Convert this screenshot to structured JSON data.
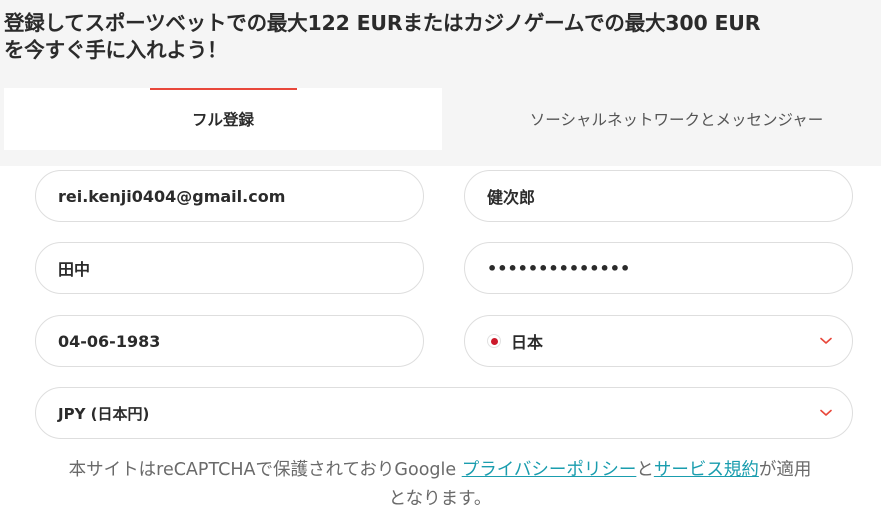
{
  "promo": {
    "headline": "登録してスポーツベットでの最大122 EURまたはカジノゲームでの最大300 EUR\nを今すぐ手に入れよう！"
  },
  "tabs": [
    {
      "label": "フル登録",
      "active": true
    },
    {
      "label": "ソーシャルネットワークとメッセンジャー",
      "active": false
    }
  ],
  "form": {
    "email": "rei.kenji0404@gmail.com",
    "first_name": "健次郎",
    "last_name": "田中",
    "password_masked": "••••••••••••••",
    "birth_date": "04-06-1983",
    "country": "日本",
    "currency": "JPY (日本円)"
  },
  "recaptcha": {
    "text_before": "本サイトはreCAPTCHAで保護されておりGoogle ",
    "privacy_link": "プライバシーポリシー",
    "connector": "と",
    "terms_link": "サービス規約",
    "text_after": "が適用となります。"
  },
  "colors": {
    "accent_red": "#e8473a",
    "link_teal": "#1a9dae",
    "japan_flag_red": "#cc1a2b"
  },
  "icons": {
    "chevron": "chevron-down-icon",
    "flag": "japan-flag-icon"
  }
}
